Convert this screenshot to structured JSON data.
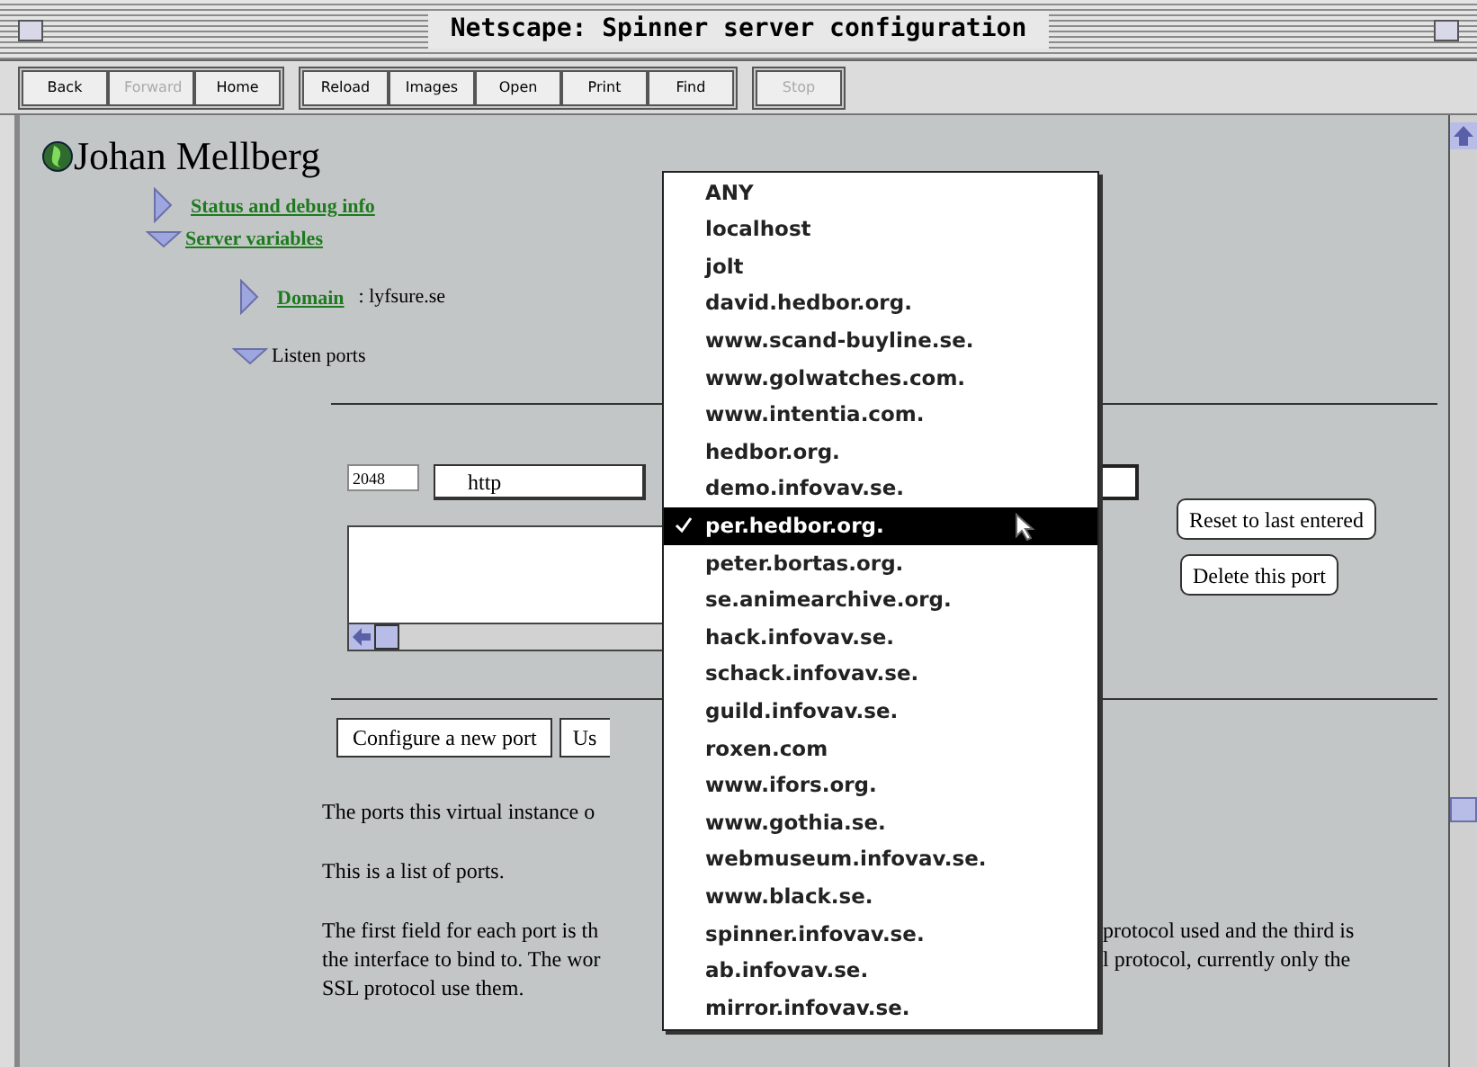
{
  "window": {
    "title": "Netscape: Spinner server configuration"
  },
  "toolbar": [
    {
      "buttons": [
        {
          "label": "Back",
          "disabled": false
        },
        {
          "label": "Forward",
          "disabled": true
        },
        {
          "label": "Home",
          "disabled": false
        }
      ]
    },
    {
      "buttons": [
        {
          "label": "Reload",
          "disabled": false
        },
        {
          "label": "Images",
          "disabled": false
        },
        {
          "label": "Open",
          "disabled": false
        },
        {
          "label": "Print",
          "disabled": false
        },
        {
          "label": "Find",
          "disabled": false
        }
      ]
    },
    {
      "buttons": [
        {
          "label": "Stop",
          "disabled": true
        }
      ]
    }
  ],
  "page": {
    "heading": "Johan Mellberg",
    "tree": [
      {
        "label": "Status and debug info",
        "link": true,
        "expanded": false
      },
      {
        "label": "Server variables",
        "link": true,
        "expanded": true,
        "children": [
          {
            "label": "Domain",
            "link": true,
            "expanded": false,
            "value": ": lyfsure.se"
          },
          {
            "label": "Listen ports",
            "link": false,
            "expanded": true
          }
        ]
      }
    ],
    "port": {
      "number": "2048",
      "protocol": "http"
    },
    "port_buttons": [
      "Reset to last entered",
      "Delete this port"
    ],
    "buttons": [
      "Configure a new port",
      "Us"
    ],
    "paragraphs": [
      {
        "left": [
          "The ports this virtual instance o"
        ]
      },
      {
        "left": [
          "This is a list of ports."
        ]
      },
      {
        "left": [
          "The first field for each port is th",
          "the interface to bind to. The wor",
          "SSL protocol use them."
        ],
        "right": [
          "protocol used and the third is",
          "l protocol, currently only the"
        ]
      }
    ]
  },
  "menu": {
    "items": [
      {
        "label": "ANY",
        "selected": false
      },
      {
        "label": "localhost",
        "selected": false
      },
      {
        "label": "jolt",
        "selected": false
      },
      {
        "label": "david.hedbor.org.",
        "selected": false
      },
      {
        "label": "www.scand-buyline.se.",
        "selected": false
      },
      {
        "label": "www.golwatches.com.",
        "selected": false
      },
      {
        "label": "www.intentia.com.",
        "selected": false
      },
      {
        "label": "hedbor.org.",
        "selected": false
      },
      {
        "label": "demo.infovav.se.",
        "selected": false
      },
      {
        "label": "per.hedbor.org.",
        "selected": true
      },
      {
        "label": "peter.bortas.org.",
        "selected": false
      },
      {
        "label": "se.animearchive.org.",
        "selected": false
      },
      {
        "label": "hack.infovav.se.",
        "selected": false
      },
      {
        "label": "schack.infovav.se.",
        "selected": false
      },
      {
        "label": "guild.infovav.se.",
        "selected": false
      },
      {
        "label": "roxen.com",
        "selected": false
      },
      {
        "label": "www.ifors.org.",
        "selected": false
      },
      {
        "label": "www.gothia.se.",
        "selected": false
      },
      {
        "label": "webmuseum.infovav.se.",
        "selected": false
      },
      {
        "label": "www.black.se.",
        "selected": false
      },
      {
        "label": "spinner.infovav.se.",
        "selected": false
      },
      {
        "label": "ab.infovav.se.",
        "selected": false
      },
      {
        "label": "mirror.infovav.se.",
        "selected": false
      }
    ]
  }
}
